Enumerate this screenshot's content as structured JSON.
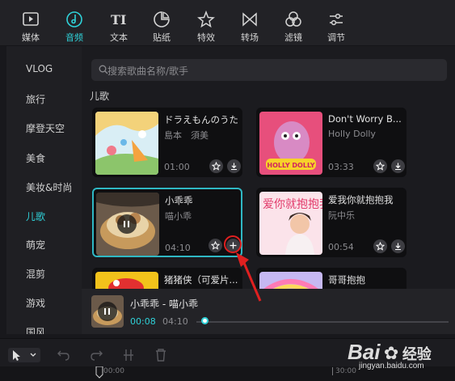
{
  "toolbar": {
    "items": [
      {
        "label": "媒体",
        "icon": "media-icon"
      },
      {
        "label": "音频",
        "icon": "audio-icon"
      },
      {
        "label": "文本",
        "icon": "text-icon"
      },
      {
        "label": "贴纸",
        "icon": "sticker-icon"
      },
      {
        "label": "特效",
        "icon": "effects-icon"
      },
      {
        "label": "转场",
        "icon": "transition-icon"
      },
      {
        "label": "滤镜",
        "icon": "filter-icon"
      },
      {
        "label": "调节",
        "icon": "adjust-icon"
      }
    ],
    "active": "音频"
  },
  "sidebar": {
    "items": [
      "VLOG",
      "旅行",
      "摩登天空",
      "美食",
      "美妆&时尚",
      "儿歌",
      "萌宠",
      "混剪",
      "游戏",
      "国风"
    ],
    "active": "儿歌"
  },
  "search": {
    "placeholder": "搜索歌曲名称/歌手"
  },
  "section_title": "儿歌",
  "cards": [
    {
      "title": "ドラえもんのうた",
      "artist": "島本　須美",
      "duration": "01:00"
    },
    {
      "title": "Don't Worry B...",
      "artist": "Holly Dolly",
      "duration": "03:33"
    },
    {
      "title": "小乖乖",
      "artist": "喵小乖",
      "duration": "04:10"
    },
    {
      "title": "爱我你就抱抱我",
      "artist": "阮中乐",
      "duration": "00:54"
    },
    {
      "title": "猪猪侠（可爱片...",
      "artist": "",
      "duration": ""
    },
    {
      "title": "哥哥抱抱",
      "artist": "",
      "duration": ""
    }
  ],
  "now_playing": {
    "title": "小乖乖 - 喵小乖",
    "current": "00:08",
    "total": "04:10",
    "progress": 0.02
  },
  "timeline": {
    "ticks": [
      "00:00",
      "30:00"
    ]
  },
  "thumb_text": {
    "card2": "HOLLY DOLLY",
    "card4": "爱你就抱抱我"
  },
  "watermark": {
    "brand": "Bai",
    "suffix": "经验",
    "url": "jingyan.baidu.com"
  },
  "colors": {
    "accent": "#2fd1d8",
    "highlight": "#e02020"
  }
}
